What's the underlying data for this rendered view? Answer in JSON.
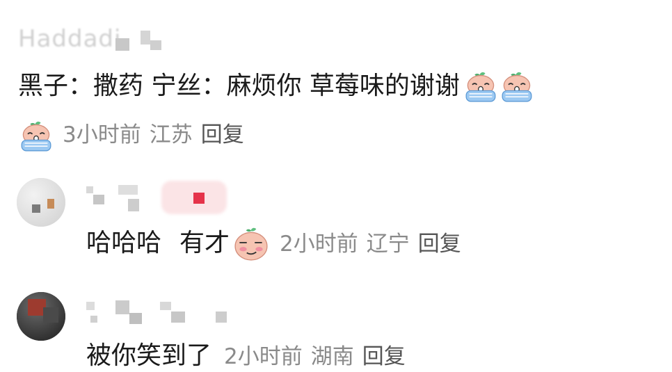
{
  "comment1": {
    "username_masked": "Haddadi",
    "text": "黑子：撒药 宁丝：麻烦你 草莓味的谢谢",
    "time": "3小时前",
    "location": "江苏",
    "reply_label": "回复",
    "emoji_inline": "crying-emoji",
    "emoji_meta": "crying-emoji"
  },
  "comment2": {
    "text_part1": "哈哈哈",
    "text_part2": "有才",
    "time": "2小时前",
    "location": "辽宁",
    "reply_label": "回复",
    "emoji_inline": "smirk-emoji"
  },
  "comment3": {
    "text": "被你笑到了",
    "time": "2小时前",
    "location": "湖南",
    "reply_label": "回复"
  },
  "colors": {
    "text": "#1a1a1a",
    "meta": "#8a8a8a",
    "emoji_skin": "#f6c4b2",
    "emoji_tears": "#7fb8ef",
    "badge_pink": "#fbe4e6",
    "badge_red": "#e5334a"
  }
}
